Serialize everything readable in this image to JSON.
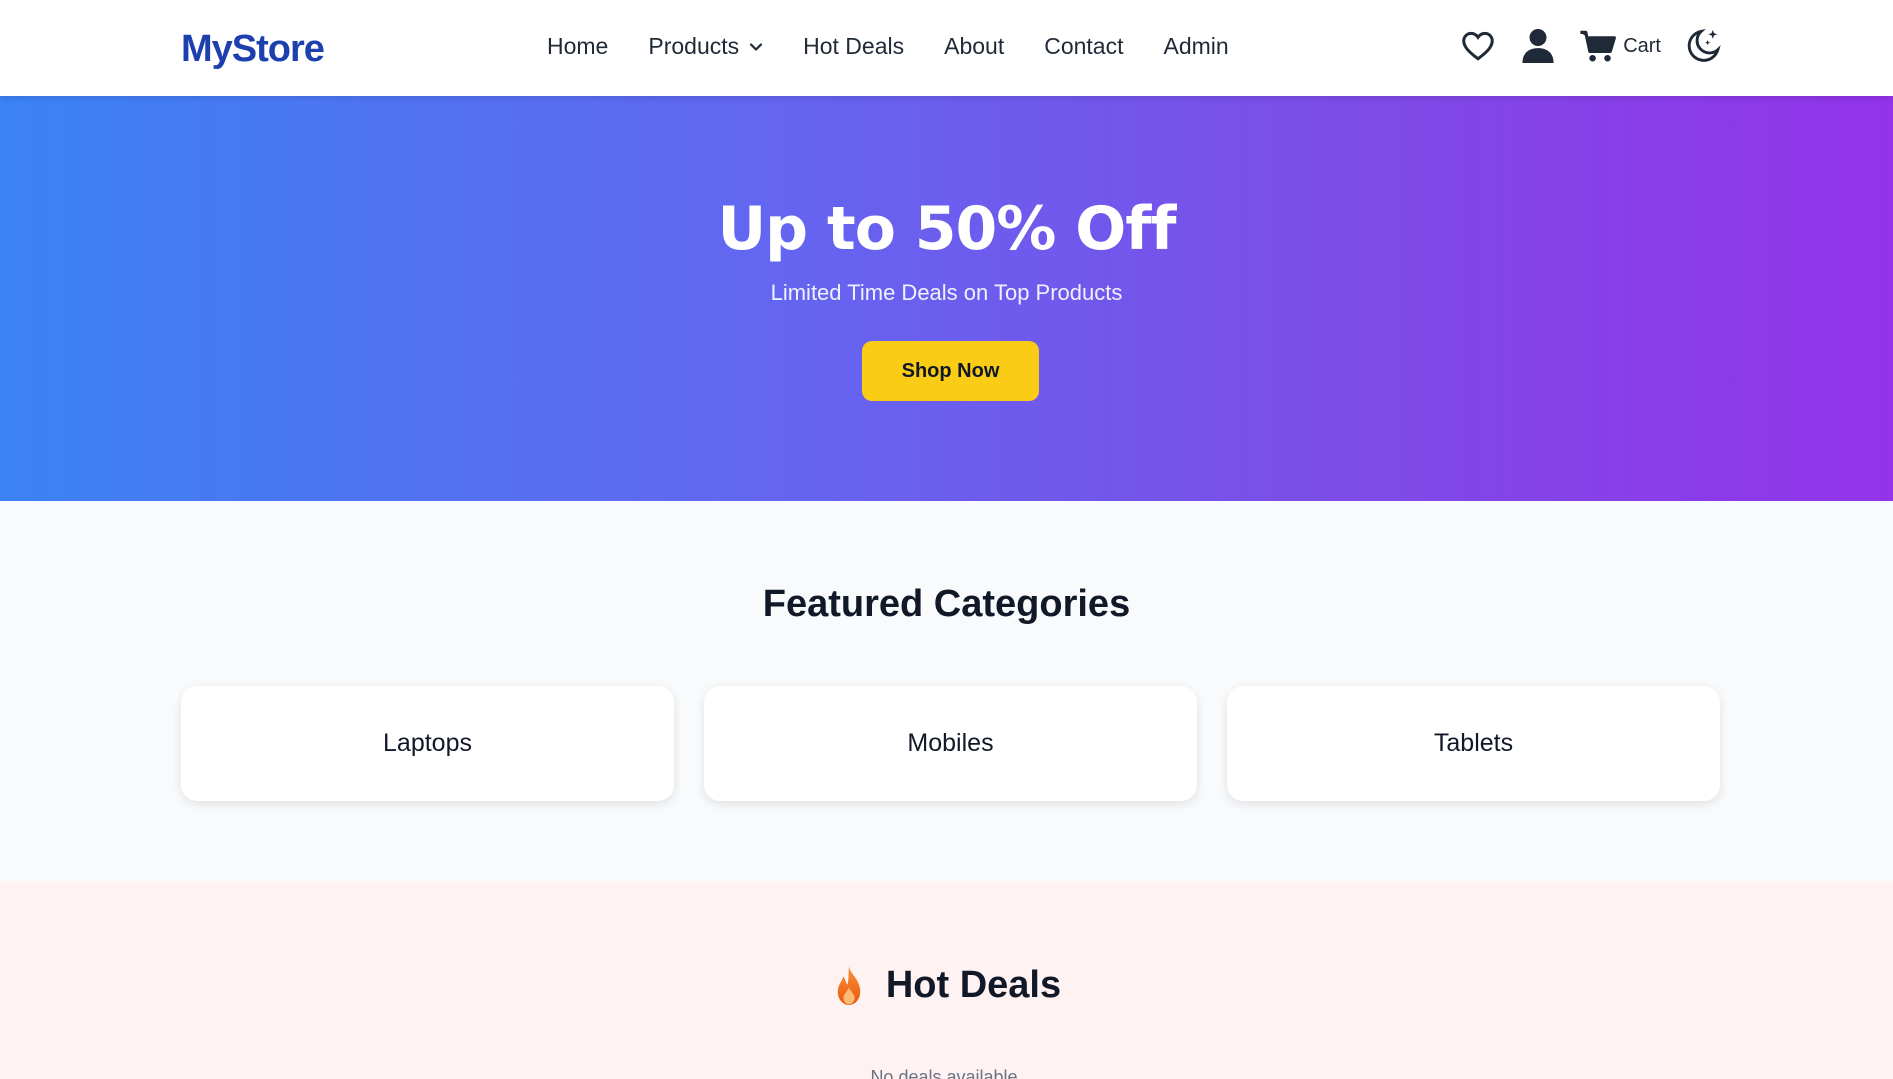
{
  "header": {
    "logo": "MyStore",
    "nav": [
      {
        "label": "Home"
      },
      {
        "label": "Products",
        "has_dropdown": true
      },
      {
        "label": "Hot Deals"
      },
      {
        "label": "About"
      },
      {
        "label": "Contact"
      },
      {
        "label": "Admin"
      }
    ],
    "icons": {
      "wishlist": "heart-icon",
      "account": "user-icon",
      "cart": "cart-icon",
      "theme": "moon-stars-icon"
    },
    "cart_label": "Cart"
  },
  "hero": {
    "title": "Up to 50% Off",
    "subtitle": "Limited Time Deals on Top Products",
    "cta_label": "Shop Now",
    "gradient": [
      "#3b82f6",
      "#9333ea"
    ],
    "cta_color": "#facc15"
  },
  "categories": {
    "title": "Featured Categories",
    "items": [
      {
        "label": "Laptops"
      },
      {
        "label": "Mobiles"
      },
      {
        "label": "Tablets"
      }
    ]
  },
  "deals": {
    "title": "Hot Deals",
    "icon": "flame-icon",
    "empty_text": "No deals available."
  },
  "colors": {
    "brand": "#1e40af",
    "categories_bg": "#f8fafc",
    "deals_bg": "#fef2f2"
  }
}
